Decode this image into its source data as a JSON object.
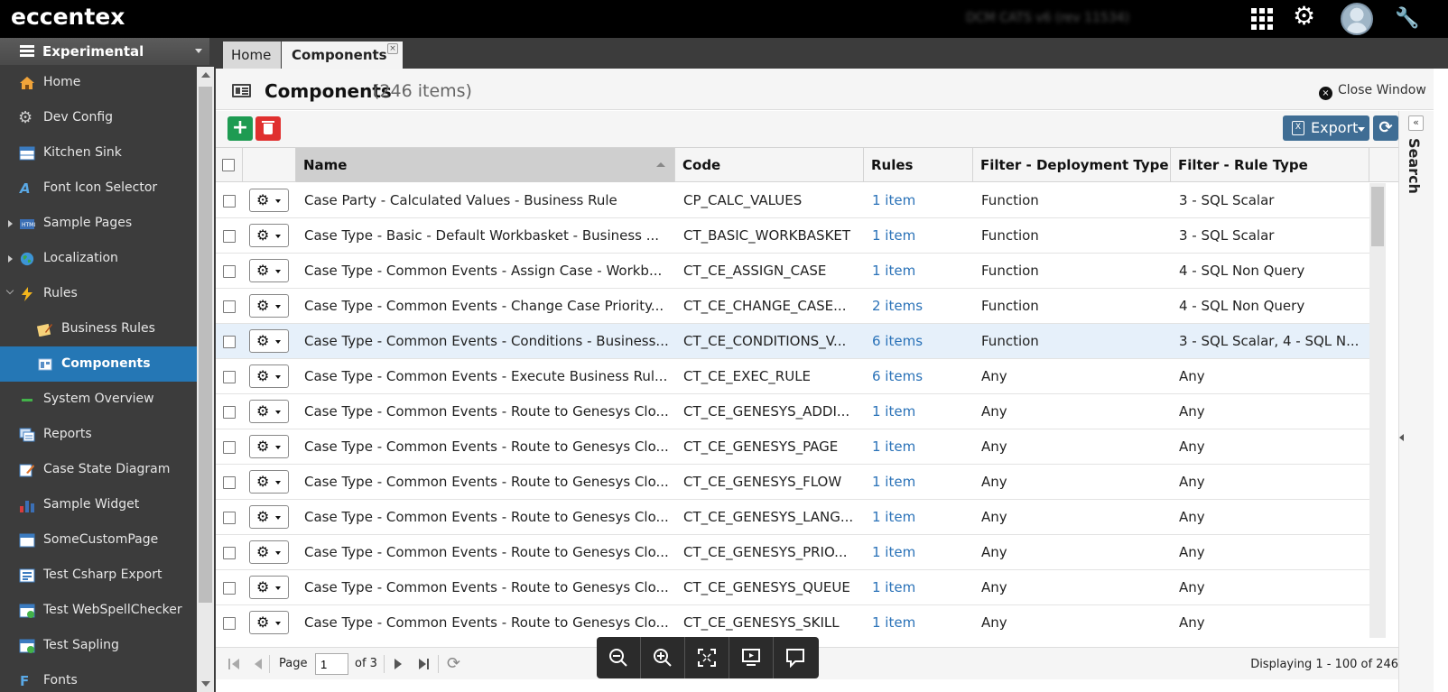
{
  "app": {
    "logo": "eccentex",
    "user_label": "DCM CATS v6 (rev 11534)"
  },
  "sidebar": {
    "header": "Experimental",
    "items": [
      {
        "label": "Home",
        "icon": "home-icon"
      },
      {
        "label": "Dev Config",
        "icon": "gear-icon"
      },
      {
        "label": "Kitchen Sink",
        "icon": "table-icon"
      },
      {
        "label": "Font Icon Selector",
        "icon": "font-icon"
      },
      {
        "label": "Sample Pages",
        "icon": "html-icon"
      },
      {
        "label": "Localization",
        "icon": "globe-icon"
      },
      {
        "label": "Rules",
        "icon": "lightning-icon"
      },
      {
        "label": "Business Rules",
        "icon": "edit-rule-icon"
      },
      {
        "label": "Components",
        "icon": "component-icon"
      },
      {
        "label": "System Overview",
        "icon": "minus-icon"
      },
      {
        "label": "Reports",
        "icon": "report-icon"
      },
      {
        "label": "Case State Diagram",
        "icon": "diagram-icon"
      },
      {
        "label": "Sample Widget",
        "icon": "widget-icon"
      },
      {
        "label": "SomeCustomPage",
        "icon": "window-icon"
      },
      {
        "label": "Test Csharp Export",
        "icon": "form-icon"
      },
      {
        "label": "Test WebSpellChecker",
        "icon": "spell-icon"
      },
      {
        "label": "Test Sapling",
        "icon": "sapling-icon"
      },
      {
        "label": "Fonts",
        "icon": "font-icon"
      }
    ]
  },
  "tabs": [
    {
      "label": "Home"
    },
    {
      "label": "Components",
      "close": "×"
    }
  ],
  "panel": {
    "title": "Components",
    "count": "(246 items)",
    "close_label": "Close Window",
    "close_icon": "×"
  },
  "toolbar": {
    "add_label": "+",
    "export_label": "Export",
    "export_icon_text": "X",
    "refresh_label": "⟳"
  },
  "search_panel": {
    "label": "Search",
    "collapse": "«"
  },
  "grid": {
    "columns": [
      "Name",
      "Code",
      "Rules",
      "Filter - Deployment Type",
      "Filter - Rule Type"
    ],
    "rows": [
      {
        "name": "Case Party - Calculated Values - Business Rule",
        "code": "CP_CALC_VALUES",
        "rules": "1 item",
        "deploy": "Function",
        "ruletype": "3 - SQL Scalar"
      },
      {
        "name": "Case Type - Basic - Default Workbasket - Business ...",
        "code": "CT_BASIC_WORKBASKET",
        "rules": "1 item",
        "deploy": "Function",
        "ruletype": "3 - SQL Scalar"
      },
      {
        "name": "Case Type - Common Events - Assign Case - Workb...",
        "code": "CT_CE_ASSIGN_CASE",
        "rules": "1 item",
        "deploy": "Function",
        "ruletype": "4 - SQL Non Query"
      },
      {
        "name": "Case Type - Common Events - Change Case Priority...",
        "code": "CT_CE_CHANGE_CASE...",
        "rules": "2 items",
        "deploy": "Function",
        "ruletype": "4 - SQL Non Query"
      },
      {
        "name": "Case Type - Common Events - Conditions - Business...",
        "code": "CT_CE_CONDITIONS_V...",
        "rules": "6 items",
        "deploy": "Function",
        "ruletype": "3 - SQL Scalar, 4 - SQL N..."
      },
      {
        "name": "Case Type - Common Events - Execute Business Rul...",
        "code": "CT_CE_EXEC_RULE",
        "rules": "6 items",
        "deploy": "Any",
        "ruletype": "Any"
      },
      {
        "name": "Case Type - Common Events - Route to Genesys Clo...",
        "code": "CT_CE_GENESYS_ADDI...",
        "rules": "1 item",
        "deploy": "Any",
        "ruletype": "Any"
      },
      {
        "name": "Case Type - Common Events - Route to Genesys Clo...",
        "code": "CT_CE_GENESYS_PAGE",
        "rules": "1 item",
        "deploy": "Any",
        "ruletype": "Any"
      },
      {
        "name": "Case Type - Common Events - Route to Genesys Clo...",
        "code": "CT_CE_GENESYS_FLOW",
        "rules": "1 item",
        "deploy": "Any",
        "ruletype": "Any"
      },
      {
        "name": "Case Type - Common Events - Route to Genesys Clo...",
        "code": "CT_CE_GENESYS_LANG...",
        "rules": "1 item",
        "deploy": "Any",
        "ruletype": "Any"
      },
      {
        "name": "Case Type - Common Events - Route to Genesys Clo...",
        "code": "CT_CE_GENESYS_PRIO...",
        "rules": "1 item",
        "deploy": "Any",
        "ruletype": "Any"
      },
      {
        "name": "Case Type - Common Events - Route to Genesys Clo...",
        "code": "CT_CE_GENESYS_QUEUE",
        "rules": "1 item",
        "deploy": "Any",
        "ruletype": "Any"
      },
      {
        "name": "Case Type - Common Events - Route to Genesys Clo...",
        "code": "CT_CE_GENESYS_SKILL",
        "rules": "1 item",
        "deploy": "Any",
        "ruletype": "Any"
      }
    ]
  },
  "pager": {
    "page_label": "Page",
    "page_value": "1",
    "of_label": "of 3",
    "display_text": "Displaying 1 - 100 of 246"
  },
  "colors": {
    "accent": "#2577b5",
    "add": "#1e9b52",
    "delete": "#e0302f",
    "export": "#3f6d94",
    "link": "#2a72b8"
  }
}
